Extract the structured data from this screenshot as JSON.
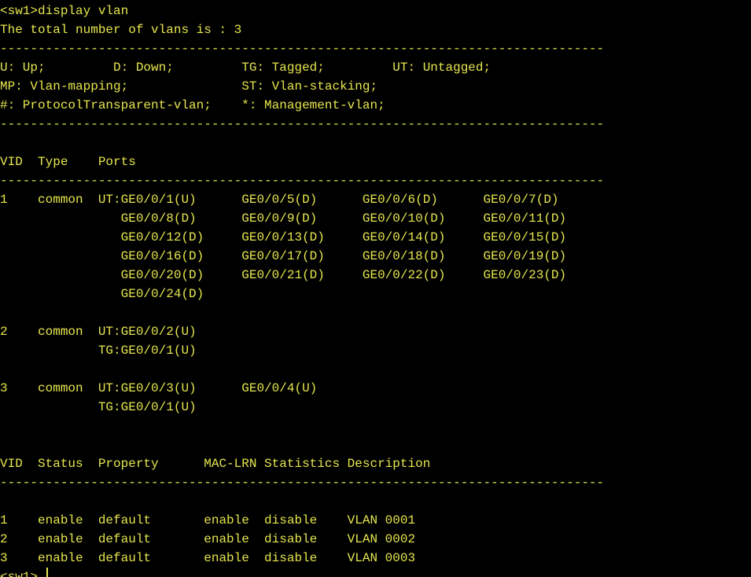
{
  "terminal": {
    "text_color": "#e6e64e",
    "background": "#000000",
    "lines": [
      "<sw1>display vlan",
      "The total number of vlans is : 3",
      "--------------------------------------------------------------------------------",
      "U: Up;         D: Down;         TG: Tagged;         UT: Untagged;",
      "MP: Vlan-mapping;               ST: Vlan-stacking;",
      "#: ProtocolTransparent-vlan;    *: Management-vlan;",
      "--------------------------------------------------------------------------------",
      "",
      "VID  Type    Ports",
      "--------------------------------------------------------------------------------",
      "1    common  UT:GE0/0/1(U)      GE0/0/5(D)      GE0/0/6(D)      GE0/0/7(D)",
      "                GE0/0/8(D)      GE0/0/9(D)      GE0/0/10(D)     GE0/0/11(D)",
      "                GE0/0/12(D)     GE0/0/13(D)     GE0/0/14(D)     GE0/0/15(D)",
      "                GE0/0/16(D)     GE0/0/17(D)     GE0/0/18(D)     GE0/0/19(D)",
      "                GE0/0/20(D)     GE0/0/21(D)     GE0/0/22(D)     GE0/0/23(D)",
      "                GE0/0/24(D)",
      "",
      "2    common  UT:GE0/0/2(U)",
      "             TG:GE0/0/1(U)",
      "",
      "3    common  UT:GE0/0/3(U)      GE0/0/4(U)",
      "             TG:GE0/0/1(U)",
      "",
      "",
      "VID  Status  Property      MAC-LRN Statistics Description",
      "--------------------------------------------------------------------------------",
      "",
      "1    enable  default       enable  disable    VLAN 0001",
      "2    enable  default       enable  disable    VLAN 0002",
      "3    enable  default       enable  disable    VLAN 0003",
      "<sw1>"
    ]
  }
}
